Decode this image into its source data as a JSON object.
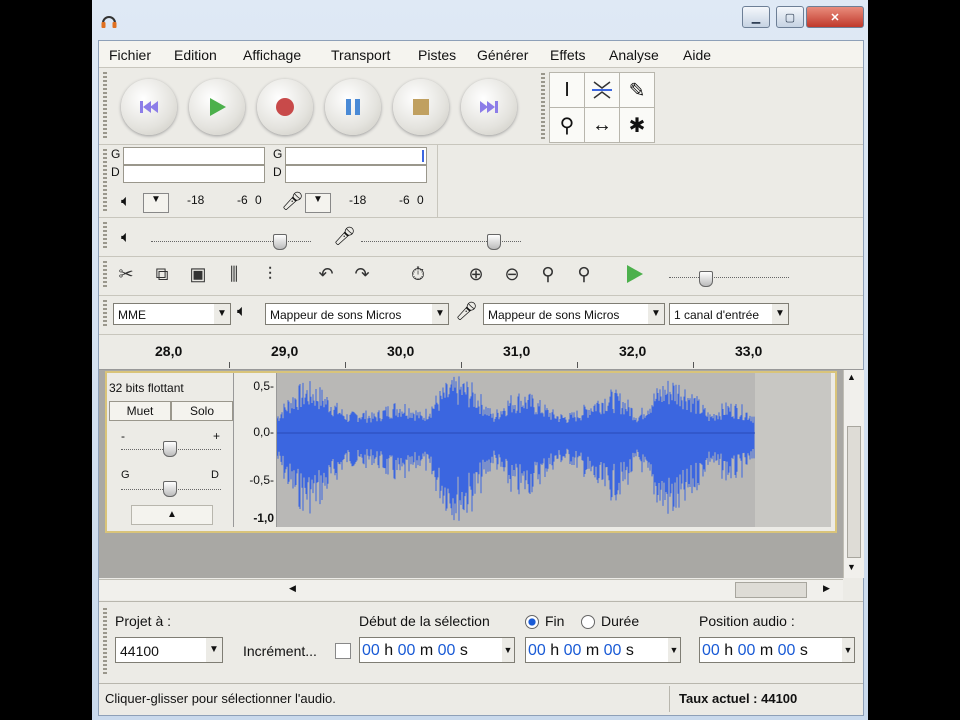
{
  "menu": [
    "Fichier",
    "Edition",
    "Affichage",
    "Transport",
    "Pistes",
    "Générer",
    "Effets",
    "Analyse",
    "Aide"
  ],
  "meters": {
    "left_label": "G",
    "right_label": "D",
    "play_scale": [
      "-18",
      "-6",
      "0"
    ],
    "rec_scale": [
      "-18",
      "-6",
      "0"
    ]
  },
  "devices": {
    "host": "MME",
    "playback": "Mappeur de sons Micros",
    "recording": "Mappeur de sons Micros",
    "channels": "1 canal d'entrée"
  },
  "timeline": {
    "ticks": [
      "28,0",
      "29,0",
      "30,0",
      "31,0",
      "32,0",
      "33,0"
    ]
  },
  "track": {
    "format": "32 bits flottant",
    "mute": "Muet",
    "solo": "Solo",
    "gain_minus": "-",
    "gain_plus": "+",
    "pan_left": "G",
    "pan_right": "D",
    "scale": [
      "0,5-",
      "0,0-",
      "-0,5-",
      "-1,0"
    ]
  },
  "selection": {
    "project_rate_label": "Projet à :",
    "project_rate": "44100",
    "snap_label": "Incrément...",
    "start_label": "Début de la sélection",
    "end_label": "Fin",
    "length_label": "Durée",
    "position_label": "Position audio :",
    "time_parts": [
      "00",
      "h",
      "00",
      "m",
      "00",
      "s"
    ]
  },
  "status": {
    "hint": "Cliquer-glisser pour sélectionner l'audio.",
    "rate": "Taux actuel : 44100"
  },
  "colors": {
    "waveform": "#3b66e0",
    "accent_blue": "#1a5bd6"
  }
}
